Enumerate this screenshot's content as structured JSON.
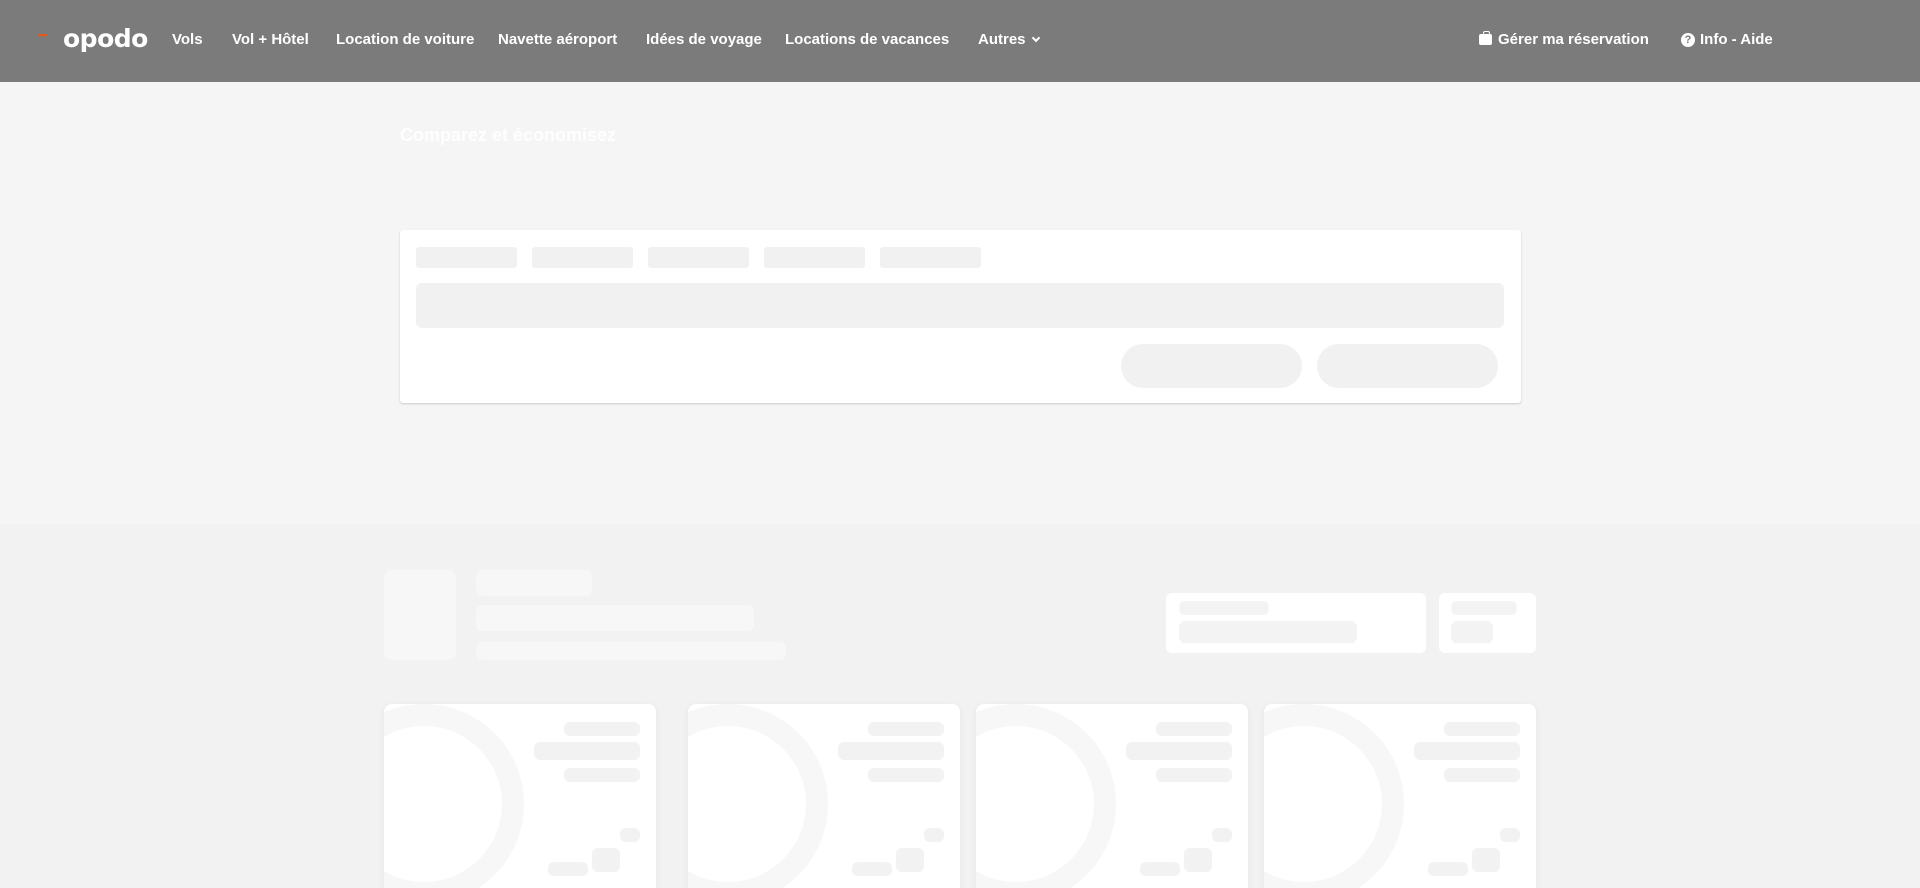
{
  "header": {
    "logo_text": "opodo",
    "logo_dots": "▪▪▪▪",
    "nav": [
      {
        "label": "Vols"
      },
      {
        "label": "Vol + Hôtel"
      },
      {
        "label": "Location de voiture"
      },
      {
        "label": "Navette aéroport"
      },
      {
        "label": "Idées de voyage"
      },
      {
        "label": "Locations de vacances"
      },
      {
        "label": "Autres"
      }
    ],
    "manage_booking": "Gérer ma réservation",
    "help": "Info - Aide",
    "help_glyph": "?"
  },
  "hero": {
    "title": "Comparez et économisez"
  },
  "colors": {
    "header_bg": "#7b7b7b",
    "brand_accent": "#e8591b",
    "page_bg": "#f2f2f2",
    "skeleton": "#f1f1f1"
  },
  "icons": {
    "manage_booking": "briefcase-icon",
    "help": "question-circle-icon",
    "dropdown": "chevron-down-icon"
  }
}
